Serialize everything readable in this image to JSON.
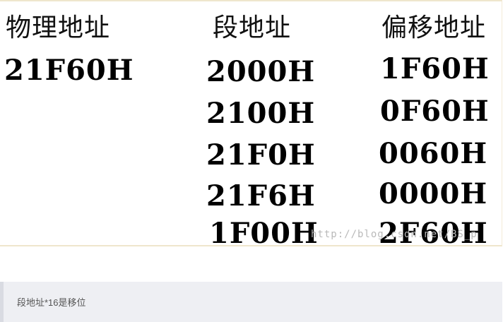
{
  "table": {
    "headers": [
      "物理地址",
      "段地址",
      "偏移地址"
    ],
    "physical_address": "21F60H",
    "segment_addresses": [
      "2000H",
      "2100H",
      "21F0H",
      "21F6H",
      "1F00H"
    ],
    "offset_addresses": [
      "1F60H",
      "0F60H",
      "0060H",
      "0000H",
      "2F60H"
    ]
  },
  "watermark": "http://blog.csdn.net/BS_p",
  "quote": {
    "text": "段地址*16是移位"
  }
}
